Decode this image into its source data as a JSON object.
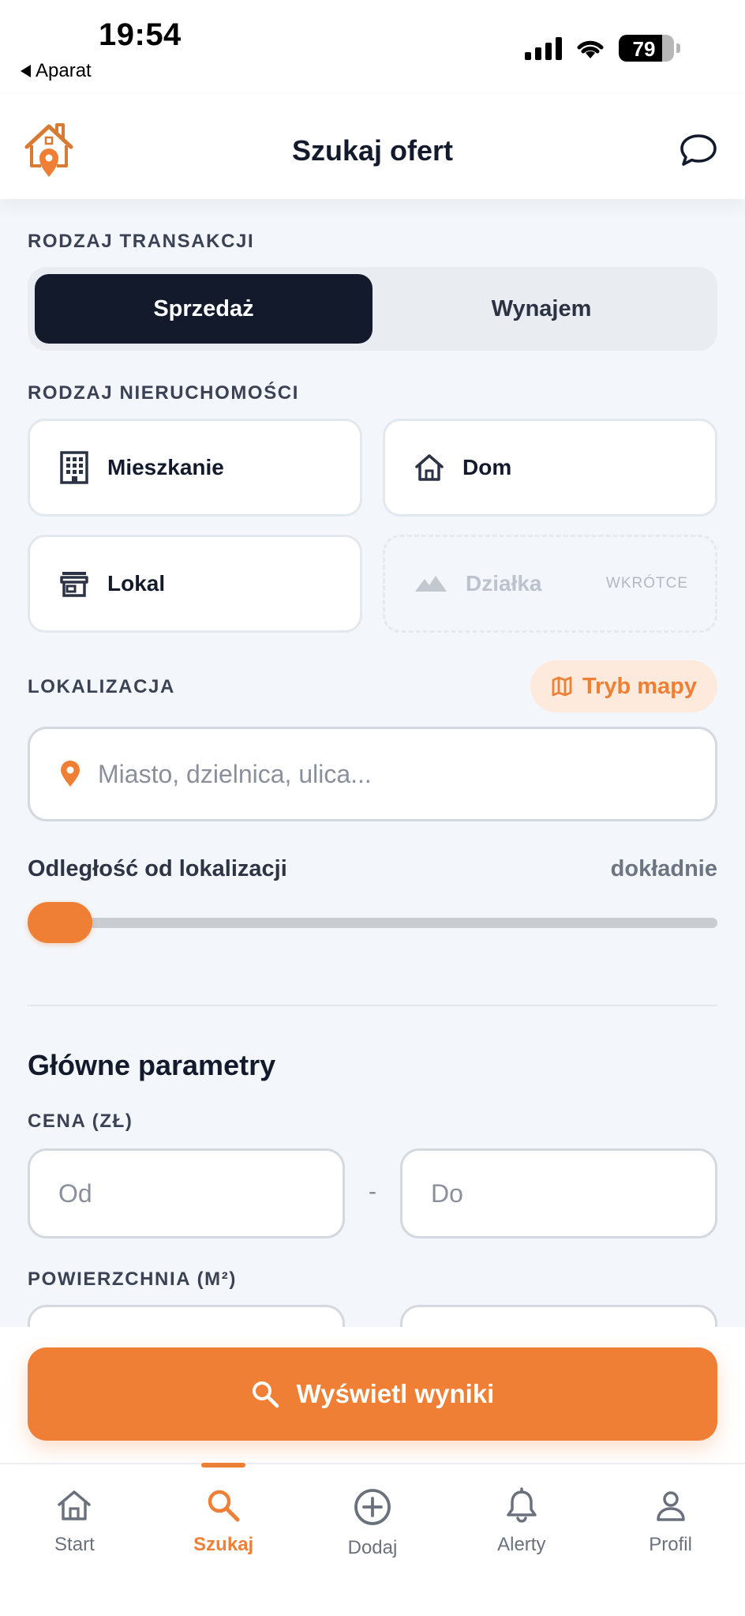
{
  "status_bar": {
    "time": "19:54",
    "back_app": "Aparat",
    "battery": "79",
    "battery_level": 0.79
  },
  "header": {
    "title": "Szukaj ofert",
    "logo_icon": "house-pin-logo",
    "chat_icon": "chat-bubble-icon"
  },
  "transaction": {
    "label": "RODZAJ TRANSAKCJI",
    "options": [
      {
        "label": "Sprzedaż",
        "active": true
      },
      {
        "label": "Wynajem",
        "active": false
      }
    ]
  },
  "property_type": {
    "label": "RODZAJ NIERUCHOMOŚCI",
    "options": [
      {
        "label": "Mieszkanie",
        "icon": "apartment-building-icon"
      },
      {
        "label": "Dom",
        "icon": "house-icon"
      },
      {
        "label": "Lokal",
        "icon": "storefront-icon"
      },
      {
        "label": "Działka",
        "icon": "terrain-icon",
        "badge": "WKRÓTCE",
        "disabled": true
      }
    ]
  },
  "location": {
    "label": "LOKALIZACJA",
    "map_mode_label": "Tryb mapy",
    "placeholder": "Miasto, dzielnica, ulica...",
    "value": ""
  },
  "distance": {
    "title": "Odległość od lokalizacji",
    "value_label": "dokładnie",
    "slider_value": 0
  },
  "main_params": {
    "heading": "Główne parametry",
    "price": {
      "label": "CENA (ZŁ)",
      "from_placeholder": "Od",
      "to_placeholder": "Do",
      "separator": "-"
    },
    "area": {
      "label": "POWIERZCHNIA (M²)"
    }
  },
  "cta": {
    "label": "Wyświetl wyniki",
    "icon": "search-icon"
  },
  "tabs": [
    {
      "label": "Start",
      "icon": "home-icon",
      "active": false
    },
    {
      "label": "Szukaj",
      "icon": "search-icon",
      "active": true
    },
    {
      "label": "Dodaj",
      "icon": "plus-circle-icon",
      "active": false
    },
    {
      "label": "Alerty",
      "icon": "bell-icon",
      "active": false
    },
    {
      "label": "Profil",
      "icon": "user-icon",
      "active": false
    }
  ],
  "colors": {
    "accent": "#ef7f35",
    "dark": "#121a2c",
    "background": "#f3f6fa"
  }
}
